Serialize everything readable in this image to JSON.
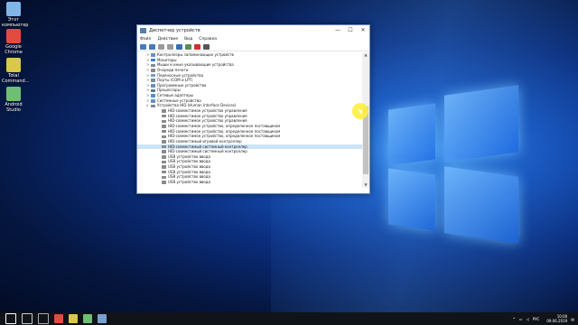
{
  "desktop": {
    "icons": [
      {
        "label": "Этот компьютер",
        "icon": "computer-icon",
        "color": "#7fb7e8"
      },
      {
        "label": "Google Chrome",
        "icon": "chrome-icon",
        "color": "#e24c3f"
      },
      {
        "label": "Total Command...",
        "icon": "total-commander-icon",
        "color": "#d9c84a"
      },
      {
        "label": "Android Studio",
        "icon": "android-studio-icon",
        "color": "#6fbf73"
      }
    ]
  },
  "window": {
    "title": "Диспетчер устройств",
    "menu": [
      "Файл",
      "Действие",
      "Вид",
      "Справка"
    ],
    "toolbar_icons": [
      "back-icon",
      "forward-icon",
      "properties-icon",
      "help-icon",
      "scan-icon",
      "update-driver-icon",
      "uninstall-icon",
      "disable-icon"
    ],
    "tree": [
      {
        "label": "Контроллеры запоминающих устройств",
        "level": 1,
        "expander": ">",
        "icon_color": "#6a8fbf"
      },
      {
        "label": "Мониторы",
        "level": 1,
        "expander": ">",
        "icon_color": "#3f7fd0"
      },
      {
        "label": "Мыши и иные указывающие устройства",
        "level": 1,
        "expander": ">",
        "icon_color": "#7a8a99"
      },
      {
        "label": "Очереди печати",
        "level": 1,
        "expander": ">",
        "icon_color": "#8a8a8a"
      },
      {
        "label": "Переносные устройства",
        "level": 1,
        "expander": ">",
        "icon_color": "#6a9fcf"
      },
      {
        "label": "Порты (COM и LPT)",
        "level": 1,
        "expander": ">",
        "icon_color": "#7a8a99"
      },
      {
        "label": "Программные устройства",
        "level": 1,
        "expander": ">",
        "icon_color": "#6a8fbf"
      },
      {
        "label": "Процессоры",
        "level": 1,
        "expander": ">",
        "icon_color": "#5a7a8a"
      },
      {
        "label": "Сетевые адаптеры",
        "level": 1,
        "expander": ">",
        "icon_color": "#4f8fcf"
      },
      {
        "label": "Системные устройства",
        "level": 1,
        "expander": ">",
        "icon_color": "#6a8fbf"
      },
      {
        "label": "Устройства HID (Human Interface Devices)",
        "level": 1,
        "expander": "v",
        "icon_color": "#7a8a99"
      },
      {
        "label": "HID-совместимое устройство управления",
        "level": 2,
        "expander": "",
        "icon_color": "#8a8a8a"
      },
      {
        "label": "HID-совместимое устройство управления",
        "level": 2,
        "expander": "",
        "icon_color": "#8a8a8a"
      },
      {
        "label": "HID-совместимое устройство управления",
        "level": 2,
        "expander": "",
        "icon_color": "#8a8a8a"
      },
      {
        "label": "HID-совместимое устройство, определенное поставщиком",
        "level": 2,
        "expander": "",
        "icon_color": "#8a8a8a"
      },
      {
        "label": "HID-совместимое устройство, определенное поставщиком",
        "level": 2,
        "expander": "",
        "icon_color": "#8a8a8a"
      },
      {
        "label": "HID-совместимое устройство, определенное поставщиком",
        "level": 2,
        "expander": "",
        "icon_color": "#8a8a8a"
      },
      {
        "label": "HID-совместимый игровой контроллер",
        "level": 2,
        "expander": "",
        "icon_color": "#8a8a8a"
      },
      {
        "label": "HID-совместимый системный контроллер",
        "level": 2,
        "expander": "",
        "icon_color": "#8a8a8a",
        "selected": true
      },
      {
        "label": "HID-совместимый системный контроллер",
        "level": 2,
        "expander": "",
        "icon_color": "#8a8a8a"
      },
      {
        "label": "USB устройство ввода",
        "level": 2,
        "expander": "",
        "icon_color": "#8a8a8a"
      },
      {
        "label": "USB устройство ввода",
        "level": 2,
        "expander": "",
        "icon_color": "#8a8a8a"
      },
      {
        "label": "USB устройство ввода",
        "level": 2,
        "expander": "",
        "icon_color": "#8a8a8a"
      },
      {
        "label": "USB устройство ввода",
        "level": 2,
        "expander": "",
        "icon_color": "#8a8a8a"
      },
      {
        "label": "USB устройство ввода",
        "level": 2,
        "expander": "",
        "icon_color": "#8a8a8a"
      },
      {
        "label": "USB устройство ввода",
        "level": 2,
        "expander": "",
        "icon_color": "#8a8a8a"
      }
    ]
  },
  "taskbar": {
    "items": [
      "start-icon",
      "search-icon",
      "task-view-icon",
      "chrome-icon",
      "total-commander-icon",
      "android-studio-icon",
      "device-manager-icon"
    ],
    "tray": {
      "lang": "РУС",
      "time": "10:00",
      "date": "09.06.2019"
    }
  },
  "colors": {
    "accent": "#1450b8",
    "selection": "#cce4f7"
  }
}
